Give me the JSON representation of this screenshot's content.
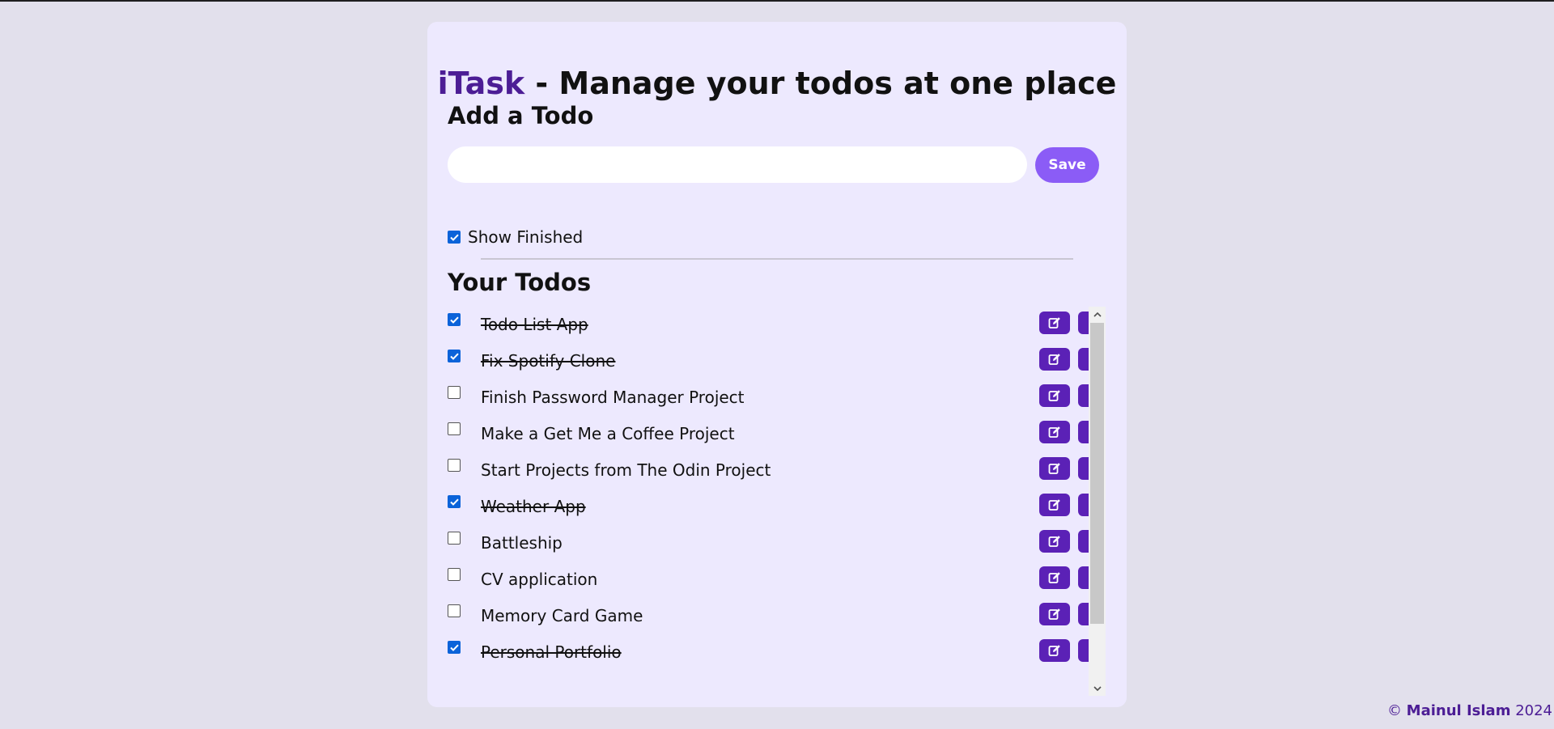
{
  "header": {
    "brand": "iTask",
    "title_rest": " - Manage your todos at one place"
  },
  "add_section": {
    "heading": "Add a Todo",
    "input_value": "",
    "input_placeholder": "",
    "save_label": "Save"
  },
  "show_finished": {
    "label": "Show Finished",
    "checked": true
  },
  "todos_section": {
    "heading": "Your Todos",
    "items": [
      {
        "text": "Todo List App",
        "done": true
      },
      {
        "text": "Fix Spotify Clone",
        "done": true
      },
      {
        "text": "Finish Password Manager Project",
        "done": false
      },
      {
        "text": "Make a Get Me a Coffee Project",
        "done": false
      },
      {
        "text": "Start Projects from The Odin Project",
        "done": false
      },
      {
        "text": "Weather App",
        "done": true
      },
      {
        "text": "Battleship",
        "done": false
      },
      {
        "text": "CV application",
        "done": false
      },
      {
        "text": "Memory Card Game",
        "done": false
      },
      {
        "text": "Personal Portfolio",
        "done": true
      }
    ],
    "edit_icon": "edit-icon",
    "delete_icon": "trash-icon"
  },
  "footer": {
    "copyright": "©",
    "author": "Mainul Islam",
    "year": "2024"
  },
  "colors": {
    "page_bg": "#e2e0ec",
    "card_bg": "#ede9fe",
    "brand": "#4c1d95",
    "save_button": "#8b5cf6",
    "action_button": "#5b21b6",
    "checkbox": "#0b63d9"
  }
}
